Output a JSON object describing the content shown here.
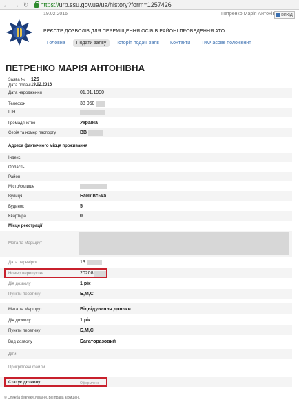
{
  "browser": {
    "back_glyph": "←",
    "forward_glyph": "→",
    "reload_glyph": "↻",
    "url_scheme": "https://",
    "url_rest": "urp.ssu.gov.ua/ua/history?form=1257426"
  },
  "header": {
    "date": "19.02.2016",
    "user": "Петренко Марія Антонівна",
    "exit_label": "вихід",
    "registry_title": "РЕЄСТР ДОЗВОЛІВ ДЛЯ ПЕРЕМІЩЕННЯ ОСІБ В РАЙОНІ ПРОВЕДЕННЯ АТО",
    "menu": [
      {
        "label": "Головна"
      },
      {
        "label": "Подати заяву"
      },
      {
        "label": "Історія подачі заяв"
      },
      {
        "label": "Контакти"
      },
      {
        "label": "Тимчасове положення"
      }
    ]
  },
  "page_title": "ПЕТРЕНКО МАРІЯ АНТОНІВНА",
  "application": {
    "number_label": "Заява №",
    "number_value": "125",
    "date_label": "Дата подачі",
    "date_value": "19.02.2016"
  },
  "personal": {
    "birth_label": "Дата народження",
    "birth_value": "01.01.1990",
    "phone_label": "Телефон",
    "phone_value": "38 050",
    "tax_label": "ІПН",
    "citizenship_label": "Громадянство",
    "citizenship_value": "Україна",
    "passport_label": "Серія та номер паспорту",
    "passport_value": "ВВ"
  },
  "address": {
    "section_title": "Адреса фактичного місця проживання",
    "index_label": "Індекс",
    "region_label": "Область",
    "district_label": "Район",
    "city_label": "Місто/селище",
    "street_label": "Вулиця",
    "street_value": "Банківська",
    "building_label": "Будинок",
    "building_value": "5",
    "apartment_label": "Квартира",
    "apartment_value": "0"
  },
  "registration": {
    "section_title": "Місце реєстрації",
    "purpose_label": "Мета та Маршрут",
    "check_date_label": "Дата перевірки",
    "check_date_value": "13.",
    "pass_number_label": "Номер перепустки",
    "pass_number_value": "20208",
    "validity_label": "Дія дозволу",
    "validity_value": "1 рік",
    "crossing_label": "Пункти перетину",
    "crossing_value": "Б,М,С"
  },
  "trip": {
    "purpose_label": "Мета та Маршрут",
    "purpose_value": "Відвідування доньки",
    "validity_label": "Дія дозволу",
    "validity_value": "1 рік",
    "crossing_label": "Пункти перетину",
    "crossing_value": "Б,М,С",
    "permit_type_label": "Вид дозволу",
    "permit_type_value": "Багаторазовий"
  },
  "extra": {
    "children_label": "Діти",
    "files_label": "Прикріплені файли",
    "status_label": "Статус дозволу",
    "status_value": "Оформлено"
  },
  "footer": "© Служба безпеки України. Всі права захищені."
}
